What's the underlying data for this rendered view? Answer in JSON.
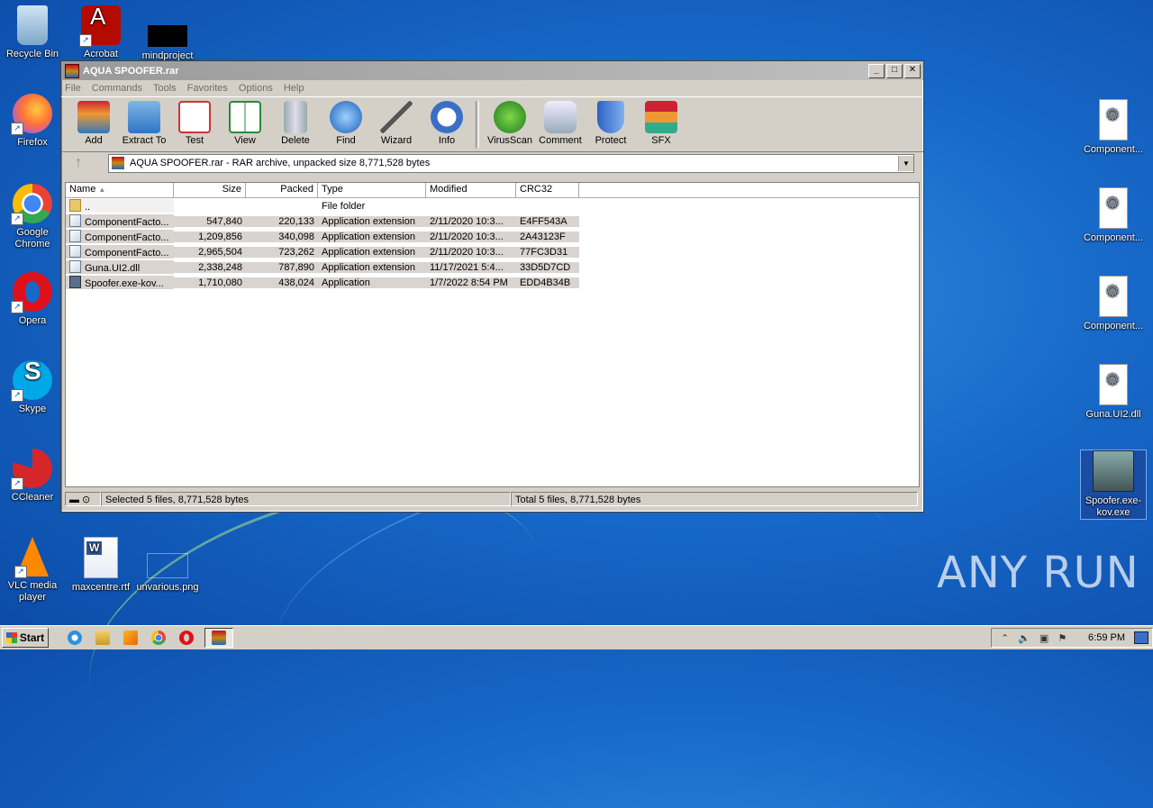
{
  "desktop": {
    "left_icons": [
      {
        "label": "Recycle Bin"
      },
      {
        "label": "Acrobat"
      },
      {
        "label": "mindproject"
      },
      {
        "label": "Firefox"
      },
      {
        "label": "Google Chrome"
      },
      {
        "label": "Opera"
      },
      {
        "label": "Skype"
      },
      {
        "label": "CCleaner"
      },
      {
        "label": "VLC media player"
      },
      {
        "label": "maxcentre.rtf"
      },
      {
        "label": "unvarious.png"
      }
    ],
    "right_icons": [
      {
        "label": "Component..."
      },
      {
        "label": "Component..."
      },
      {
        "label": "Component..."
      },
      {
        "label": "Guna.UI2.dll"
      },
      {
        "label": "Spoofer.exe-kov.exe"
      }
    ],
    "watermark": "ANY RUN"
  },
  "window": {
    "title": "AQUA SPOOFER.rar",
    "menu": [
      "File",
      "Commands",
      "Tools",
      "Favorites",
      "Options",
      "Help"
    ],
    "toolbar_group1": [
      "Add",
      "Extract To",
      "Test",
      "View",
      "Delete",
      "Find",
      "Wizard",
      "Info"
    ],
    "toolbar_group2": [
      "VirusScan",
      "Comment",
      "Protect",
      "SFX"
    ],
    "path": "AQUA SPOOFER.rar - RAR archive, unpacked size 8,771,528 bytes",
    "columns": [
      "Name",
      "Size",
      "Packed",
      "Type",
      "Modified",
      "CRC32"
    ],
    "parent_row": {
      "name": "..",
      "type": "File folder"
    },
    "rows": [
      {
        "name": "ComponentFacto...",
        "size": "547,840",
        "packed": "220,133",
        "type": "Application extension",
        "modified": "2/11/2020 10:3...",
        "crc": "E4FF543A"
      },
      {
        "name": "ComponentFacto...",
        "size": "1,209,856",
        "packed": "340,098",
        "type": "Application extension",
        "modified": "2/11/2020 10:3...",
        "crc": "2A43123F"
      },
      {
        "name": "ComponentFacto...",
        "size": "2,965,504",
        "packed": "723,262",
        "type": "Application extension",
        "modified": "2/11/2020 10:3...",
        "crc": "77FC3D31"
      },
      {
        "name": "Guna.UI2.dll",
        "size": "2,338,248",
        "packed": "787,890",
        "type": "Application extension",
        "modified": "11/17/2021 5:4...",
        "crc": "33D5D7CD"
      },
      {
        "name": "Spoofer.exe-kov...",
        "size": "1,710,080",
        "packed": "438,024",
        "type": "Application",
        "modified": "1/7/2022 8:54 PM",
        "crc": "EDD4B34B"
      }
    ],
    "status_left": "Selected 5 files, 8,771,528 bytes",
    "status_right": "Total 5 files, 8,771,528 bytes"
  },
  "taskbar": {
    "start": "Start",
    "clock": "6:59 PM"
  }
}
